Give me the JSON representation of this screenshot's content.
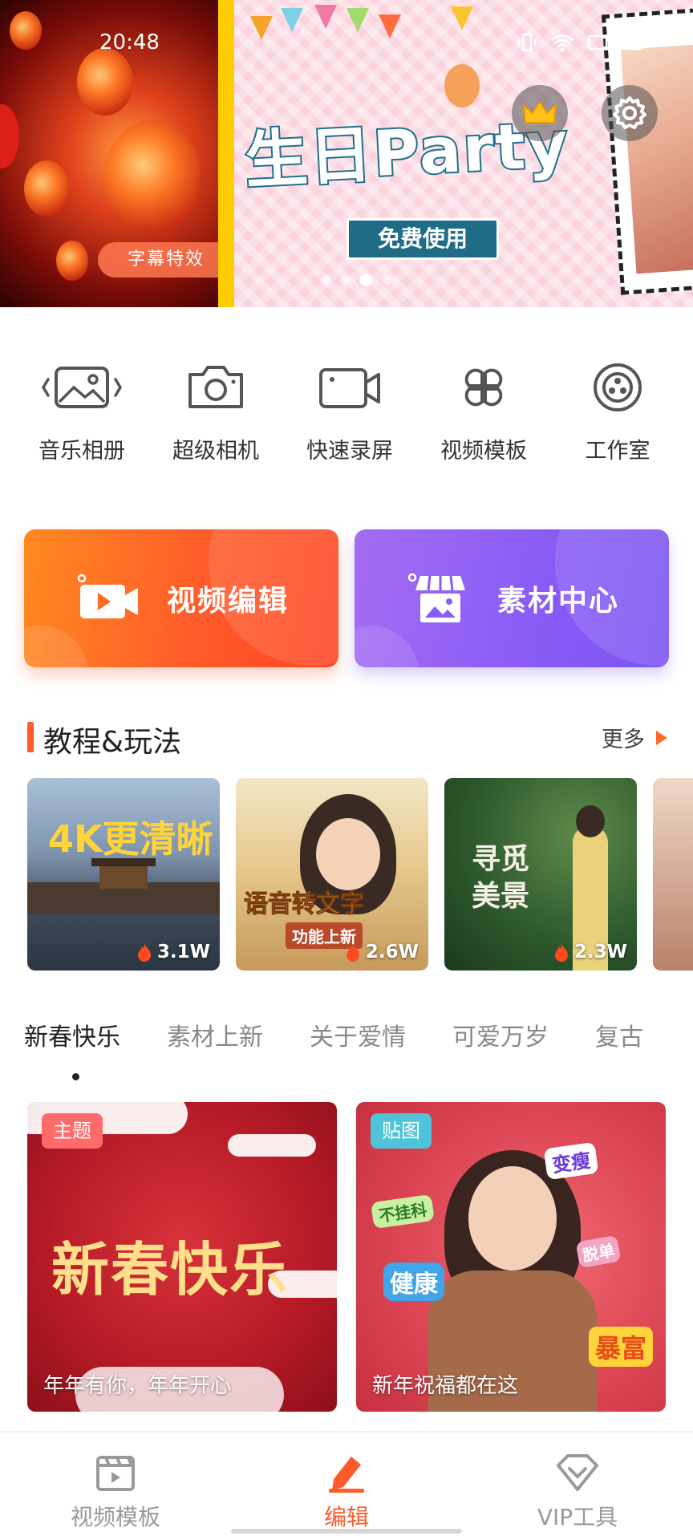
{
  "status_bar": {
    "time": "20:48"
  },
  "banner": {
    "left_caption": "字幕特效",
    "title": "生日Party",
    "cta": "免费使用",
    "page_dots": 5,
    "active_dot": 3
  },
  "tools": [
    {
      "label": "音乐相册",
      "icon": "photo-album-icon"
    },
    {
      "label": "超级相机",
      "icon": "camera-icon"
    },
    {
      "label": "快速录屏",
      "icon": "screen-record-icon"
    },
    {
      "label": "视频模板",
      "icon": "template-grid-icon"
    },
    {
      "label": "工作室",
      "icon": "studio-reel-icon"
    }
  ],
  "cards": {
    "video_edit": "视频编辑",
    "material_center": "素材中心"
  },
  "tutorials_section": {
    "title": "教程&玩法",
    "more": "更多",
    "items": [
      {
        "overlay": "4K更清晰",
        "views": "3.1W"
      },
      {
        "overlay": "语音转文字",
        "sub": "功能上新",
        "views": "2.6W"
      },
      {
        "overlay": "寻觅\n美景",
        "views": "2.3W"
      }
    ]
  },
  "categories": {
    "tabs": [
      "新春快乐",
      "素材上新",
      "关于爱情",
      "可爱万岁",
      "复古"
    ],
    "active": 0
  },
  "themes": [
    {
      "badge": "主题",
      "art_text": "新春快乐",
      "caption": "年年有你，年年开心"
    },
    {
      "badge": "贴图",
      "stickers": [
        "变瘦",
        "不挂科",
        "健康",
        "脱单",
        "暴富"
      ],
      "caption": "新年祝福都在这"
    }
  ],
  "bottom_nav": {
    "items": [
      {
        "label": "视频模板",
        "icon": "film-template-icon"
      },
      {
        "label": "编辑",
        "icon": "edit-pencil-icon"
      },
      {
        "label": "VIP工具",
        "icon": "vip-diamond-icon"
      }
    ],
    "active": 1
  },
  "colors": {
    "accent": "#ff5a2a",
    "inactive": "#999999",
    "edit_card": "#ff6a25",
    "material_card": "#8b5cf6"
  }
}
